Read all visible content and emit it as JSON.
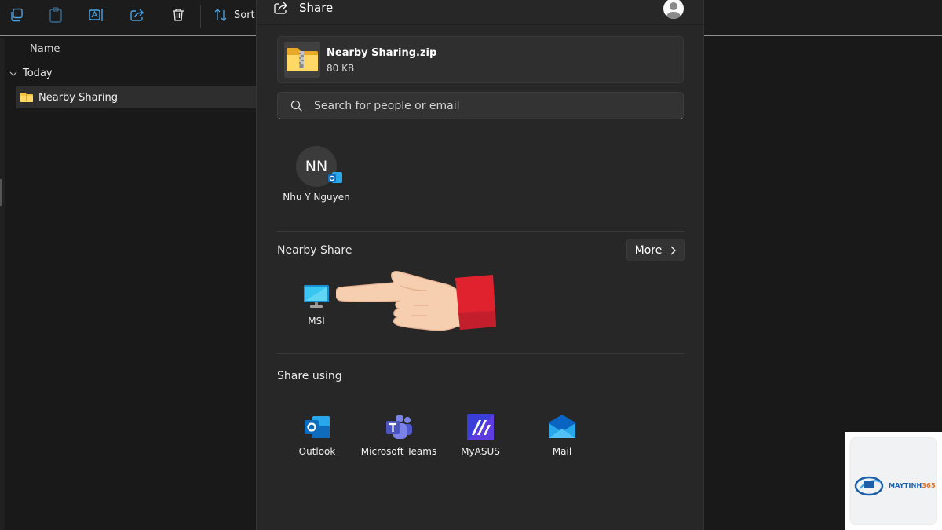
{
  "explorer": {
    "toolbar": {
      "sort_label": "Sort"
    },
    "column_header": "Name",
    "group_label": "Today",
    "file_name": "Nearby Sharing"
  },
  "share": {
    "title": "Share",
    "file": {
      "name": "Nearby Sharing.zip",
      "size": "80 KB"
    },
    "search": {
      "placeholder": "Search for people or email"
    },
    "contacts": [
      {
        "initials": "NN",
        "name": "Nhu Y Nguyen"
      }
    ],
    "nearby": {
      "title": "Nearby Share",
      "more_label": "More",
      "devices": [
        {
          "name": "MSI"
        }
      ]
    },
    "share_using": {
      "title": "Share using",
      "apps": [
        {
          "name": "Outlook"
        },
        {
          "name": "Microsoft Teams"
        },
        {
          "name": "MyASUS"
        },
        {
          "name": "Mail"
        }
      ]
    }
  },
  "watermark": {
    "brand_part1": "MAYTINH",
    "brand_part2": "365"
  },
  "colors": {
    "background": "#191919",
    "dialog": "#272727",
    "accent_blue": "#0f6cbd",
    "folder_yellow": "#f5c542"
  }
}
